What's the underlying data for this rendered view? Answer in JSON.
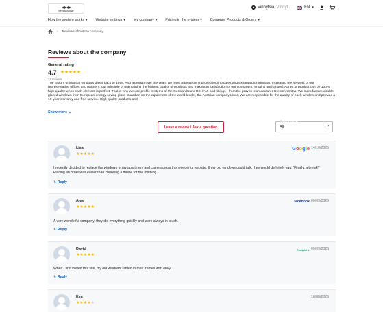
{
  "header": {
    "logo_text": "VITRAGES.UNIT",
    "location": "Vinnytsia,",
    "location_rest": " Vinnyt...",
    "language": "EN"
  },
  "nav": [
    {
      "label": "How the system works"
    },
    {
      "label": "Website settings"
    },
    {
      "label": "My company"
    },
    {
      "label": "Pricing in the system"
    },
    {
      "label": "Company Products & Orders"
    }
  ],
  "breadcrumb": {
    "current": "Reviews about the company"
  },
  "page": {
    "title": "Reviews about the company",
    "general_rating_label": "General rating",
    "rating": "4.7",
    "rating_stars": "★★★★★",
    "reviews_count": "11 reviews",
    "description": "The history of Manual windows dates back to 1998. And although over the years we have repeatedly improved technologies and expanded production, increased the network of our representative offices and partners, our principle of maintaining the highest quality of products and maximum satisfaction of our customers remains unchanged. Agree, a product can be 100% high-quality when each element is perfect. That is why we use profile systems of the German brand REHAU, and fittings - from the proven manufacturer Gretsch-Unitas. We manufacture double-glazed windows from European energy-saving glass Guardian on the equipment of the world leader, the Austrian company Lisec. We are responsible for the quality of each window and provide a 10-year warranty and free service. High quality products and",
    "show_more": "Show more",
    "leave_review": "Leave a review / Ask a question",
    "sort_label": "Review source",
    "sort_value": "All"
  },
  "reviews": [
    {
      "name": "Lisa",
      "stars": "★★★★★",
      "source": "Google",
      "date": "14/10/2025",
      "text": "I recently decided to replace the windows in my apartment and came across this wonderful website. If my old windows could talk, they would definitely say, \"Finally, a break!\" Placing an order was easier than choosing a movie for the evening.",
      "reply": "Reply"
    },
    {
      "name": "Alex",
      "stars": "★★★★★",
      "source": "facebook",
      "date": "09/09/2025",
      "text": "A very wonderful company, they did everything quickly and were always in touch.",
      "reply": "Reply"
    },
    {
      "name": "David",
      "stars": "★★★★★",
      "source": "Trustpilot",
      "date": "09/09/2025",
      "text": "When I first visited this site, my old windows rattled in their frames with envy.",
      "reply": "Reply"
    },
    {
      "name": "Eva",
      "stars": "★★★★",
      "stars_empty": "★",
      "date": "18/08/2025"
    }
  ],
  "colors": {
    "accent": "#d0203a",
    "link": "#1a5fb4",
    "star": "#f4b400"
  }
}
